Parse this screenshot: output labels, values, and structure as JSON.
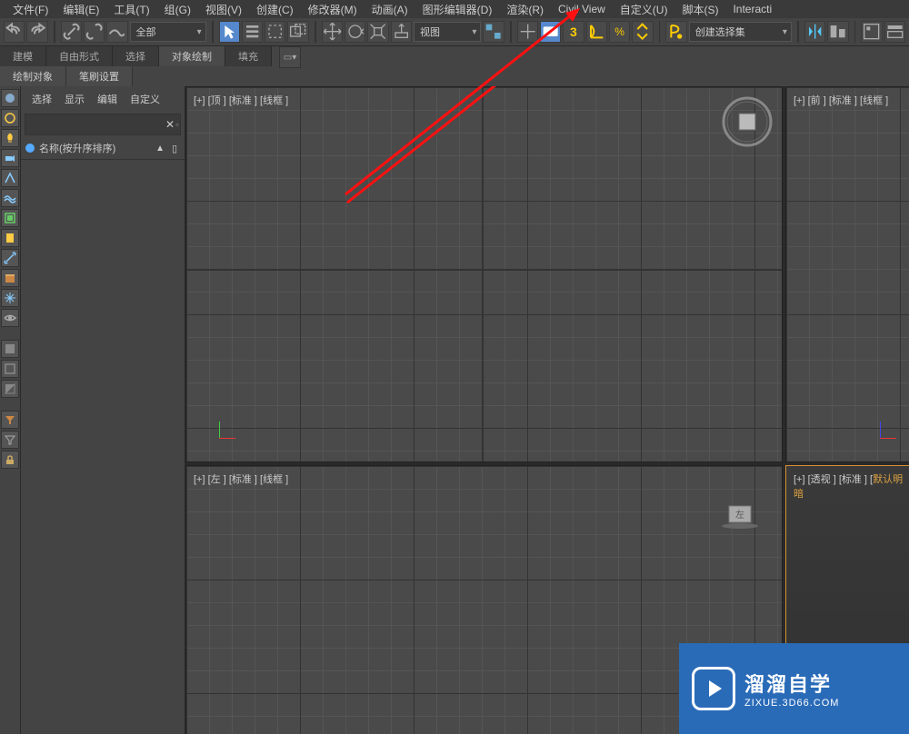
{
  "menu": [
    "文件(F)",
    "编辑(E)",
    "工具(T)",
    "组(G)",
    "视图(V)",
    "创建(C)",
    "修改器(M)",
    "动画(A)",
    "图形编辑器(D)",
    "渲染(R)",
    "Civil View",
    "自定义(U)",
    "脚本(S)",
    "Interacti"
  ],
  "toolbar": {
    "filter": "全部",
    "view": "视图",
    "assembly": "创建选择集"
  },
  "ribbon": {
    "tabs": [
      "建模",
      "自由形式",
      "选择",
      "对象绘制",
      "填充"
    ],
    "active_index": 3,
    "subtabs": [
      "绘制对象",
      "笔刷设置"
    ]
  },
  "side": {
    "tabs": [
      "选择",
      "显示",
      "编辑",
      "自定义"
    ],
    "list_header": "名称(按升序排序)"
  },
  "viewports": {
    "top": "[+] [顶 ] [标准 ] [线框 ]",
    "front": "[+] [前 ] [标准 ] [线框 ]",
    "left": "[+] [左 ] [标准 ] [线框 ]",
    "persp_pre": "[+] [透视 ] [标准 ] [",
    "persp_hl": "默认明暗"
  },
  "watermark": {
    "title": "溜溜自学",
    "url": "ZIXUE.3D66.COM"
  }
}
